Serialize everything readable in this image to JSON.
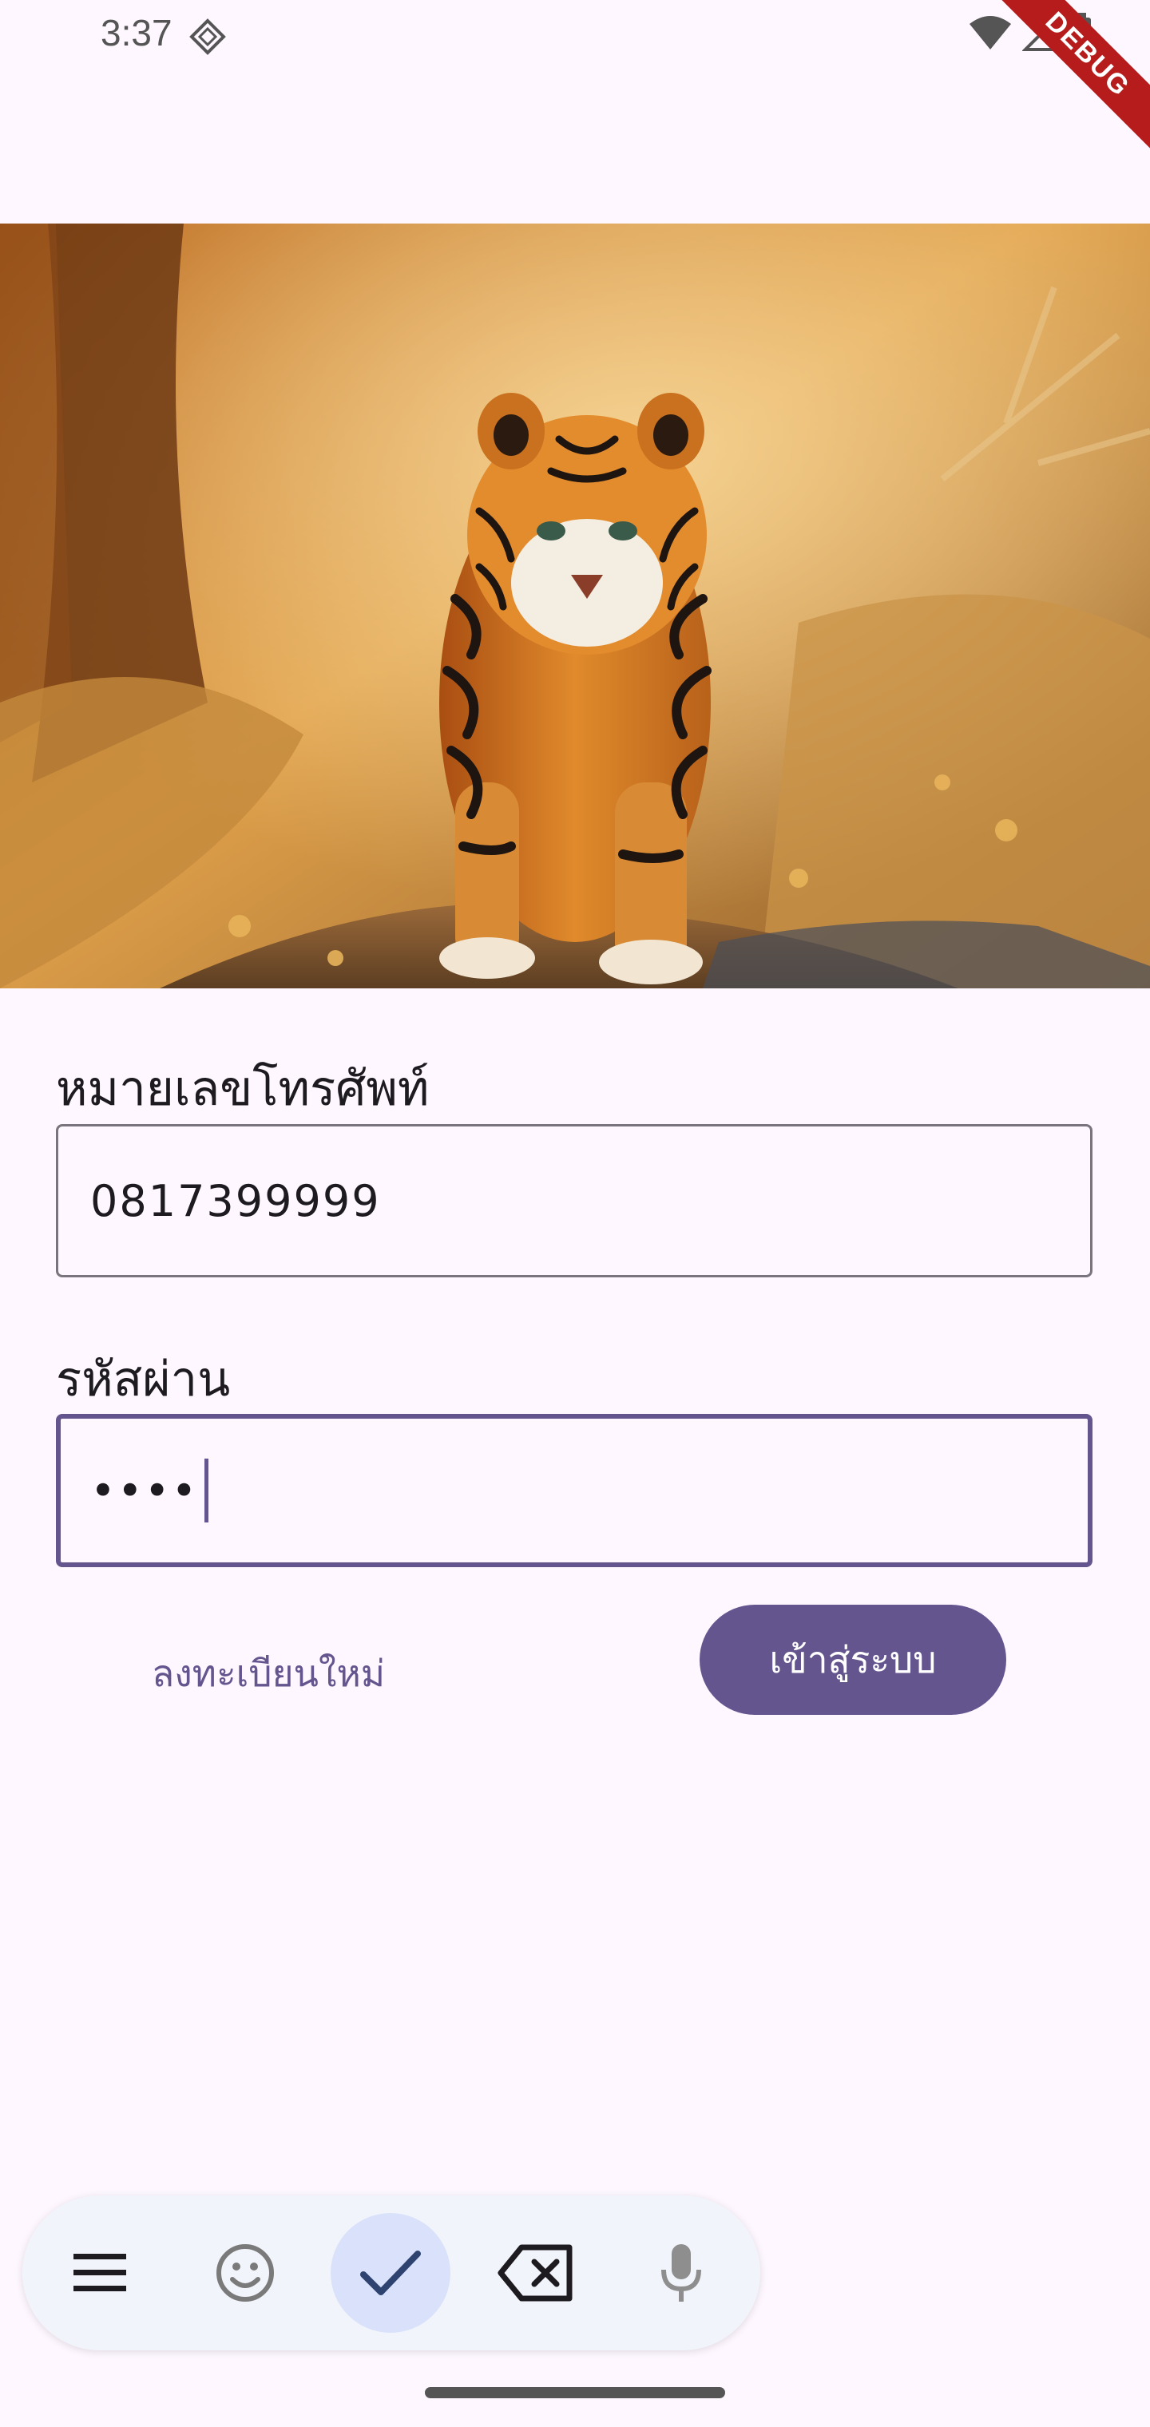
{
  "status_bar": {
    "time": "3:37",
    "debug_label": "DEBUG"
  },
  "hero": {
    "image_name": "tiger-walking-forest"
  },
  "form": {
    "phone_label": "หมายเลขโทรศัพท์",
    "phone_value": "0817399999",
    "password_label": "รหัสผ่าน",
    "password_value": "••••",
    "register_link": "ลงทะเบียนใหม่",
    "login_button": "เข้าสู่ระบบ"
  },
  "keyboard_toolbar": {
    "buttons": [
      "menu-icon",
      "emoji-icon",
      "check-icon",
      "backspace-icon",
      "microphone-icon"
    ],
    "active_button": "check-icon"
  },
  "colors": {
    "background": "#FEF7FF",
    "primary": "#65558F",
    "outline": "#79747E",
    "debug": "#B71C1C"
  }
}
